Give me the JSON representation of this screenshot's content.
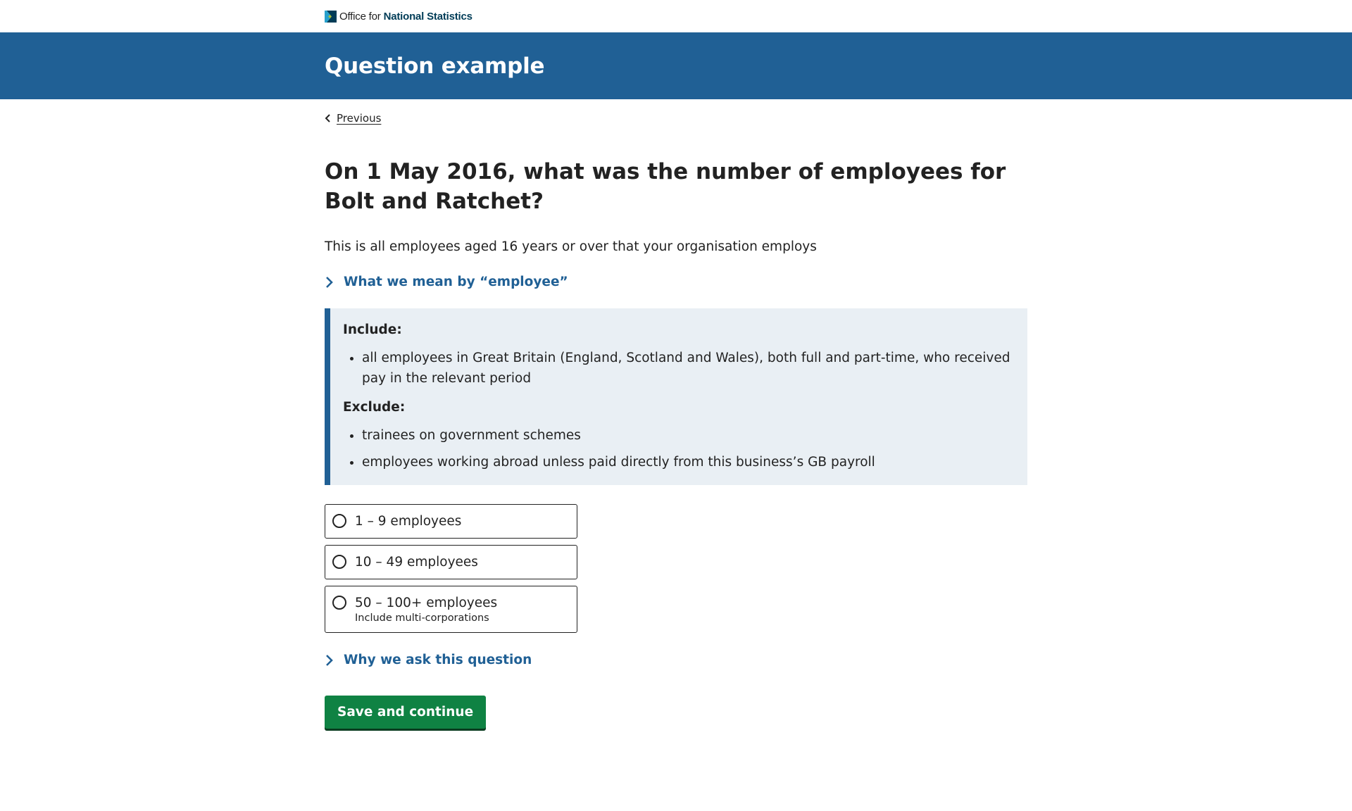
{
  "header": {
    "logo_prefix": "Office for",
    "logo_bold": "National Statistics",
    "title": "Question example"
  },
  "nav": {
    "previous_label": "Previous"
  },
  "question": {
    "title": "On 1 May 2016, what was the number of employees for Bolt and Ratchet?",
    "description": "This is all employees aged 16 years or over that your organisation employs"
  },
  "definition": {
    "toggle_label": "What we mean by “employee”",
    "include_label": "Include:",
    "include_items": [
      "all employees in Great Britain (England, Scotland and Wales), both full and part-time, who received pay in the relevant period"
    ],
    "exclude_label": "Exclude:",
    "exclude_items": [
      "trainees on government schemes",
      "employees working abroad unless paid directly from this business’s GB payroll"
    ]
  },
  "options": [
    {
      "label": "1 – 9 employees",
      "hint": ""
    },
    {
      "label": "10 – 49 employees",
      "hint": ""
    },
    {
      "label": "50 – 100+ employees",
      "hint": "Include multi-corporations"
    }
  ],
  "why": {
    "label": "Why we ask this question"
  },
  "submit": {
    "label": "Save and continue"
  },
  "colors": {
    "brand": "#206095",
    "submit": "#0f8243",
    "panel_bg": "#e9eff4"
  }
}
